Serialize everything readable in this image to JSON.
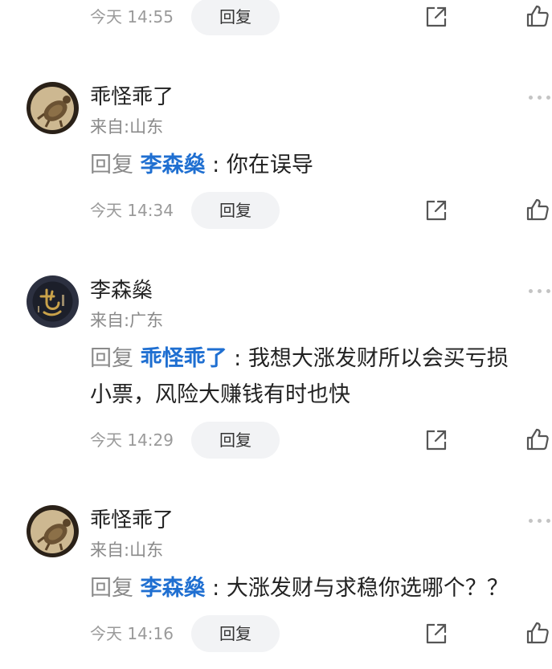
{
  "top_row": {
    "time": "今天 14:55",
    "reply_label": "回复",
    "share_icon": "share-icon",
    "like_icon": "thumbs-up-icon"
  },
  "comments": [
    {
      "username": "乖怪乖了",
      "location": "来自:山东",
      "reply_prefix": "回复",
      "mention": "李森燊",
      "separator": " : ",
      "content_line1": "你在误导",
      "content_line2": "",
      "time": "今天 14:34",
      "reply_label": "回复"
    },
    {
      "username": "李森燊",
      "location": "来自:广东",
      "reply_prefix": "回复",
      "mention": "乖怪乖了",
      "separator": " : ",
      "content_line1": "我想大涨发财所以会买亏损",
      "content_line2": "小票，风险大赚钱有时也快",
      "time": "今天 14:29",
      "reply_label": "回复"
    },
    {
      "username": "乖怪乖了",
      "location": "来自:山东",
      "reply_prefix": "回复",
      "mention": "李森燊",
      "separator": " : ",
      "content_line1": "大涨发财与求稳你选哪个？？",
      "content_line2": "",
      "time": "今天 14:16",
      "reply_label": "回复"
    }
  ],
  "colors": {
    "mention": "#1f6fd1",
    "muted": "#8a8a8a",
    "button_bg": "#f2f3f5"
  }
}
